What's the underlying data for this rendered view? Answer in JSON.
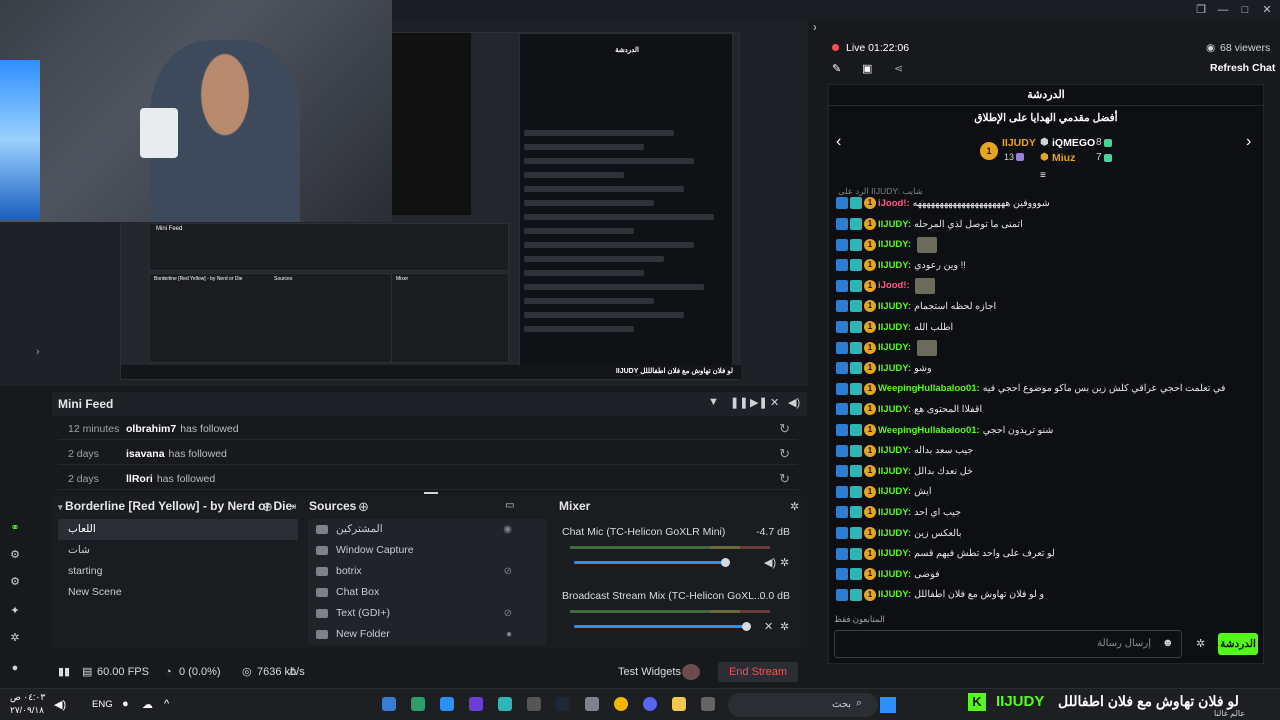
{
  "window": {
    "buttons": [
      "❐",
      "—",
      "□",
      "✕"
    ]
  },
  "preview_overlay": {
    "mini_feed_title": "Mini Feed",
    "scene_title": "Borderline [Red Yellow] - by Nerd or Die",
    "sources_title": "Sources",
    "mixer_title": "Mixer",
    "chat_title_small": "الدردشة",
    "ticker": "IIJUDY  لو فلان تهاوش مع فلان اطفالللل"
  },
  "mini_feed": {
    "title": "Mini Feed",
    "rows": [
      {
        "time": "12 minutes",
        "user": "olbrahim7",
        "action": "has followed"
      },
      {
        "time": "2 days",
        "user": "isavana",
        "action": "has followed"
      },
      {
        "time": "2 days",
        "user": "llRori",
        "action": "has followed"
      }
    ]
  },
  "scenes": {
    "title": "Borderline [Red Yellow] - by Nerd or Die",
    "items": [
      "اللعاب",
      "شات",
      "starting",
      "New Scene"
    ]
  },
  "sources": {
    "title": "Sources",
    "items": [
      "المشتركين",
      "Window Capture",
      "botrix",
      "Chat Box",
      "Text (GDI+)",
      "New Folder"
    ]
  },
  "mixer": {
    "title": "Mixer",
    "channels": [
      {
        "name": "Chat Mic (TC-Helicon GoXLR Mini)",
        "db": "-4.7 dB",
        "level": 0.88
      },
      {
        "name": "Broadcast Stream Mix (TC-Helicon GoXL...",
        "db": "0.0 dB",
        "level": 1.0
      }
    ]
  },
  "status": {
    "fps": "60.00 FPS",
    "dropped": "0 (0.0%)",
    "bitrate": "7636 kb/s",
    "test_widgets": "Test Widgets",
    "end_stream": "End Stream"
  },
  "chat": {
    "live": "Live 01:22:06",
    "viewers": "68 viewers",
    "refresh": "Refresh Chat",
    "tab": "الدردشة",
    "gift_title": "أفضل مقدمي الهدايا على الإطلاق",
    "top_gifters": [
      {
        "rank": "1",
        "name": "IIJUDY",
        "count": "13"
      },
      {
        "rank": "",
        "name": "iQMEGO",
        "count": "8"
      },
      {
        "rank": "",
        "name": "Miuz",
        "count": "7"
      }
    ],
    "reply_hint": "الرد على IIJUDY: شايب",
    "messages": [
      {
        "user": "iJood!",
        "color": "#ff5a8a",
        "text": "شوووفين هههههههههههههههههههههه",
        "emote": false
      },
      {
        "user": "IIJUDY",
        "color": "#53fc18",
        "text": "اتمنى ما توصل لذي المرحله",
        "emote": false
      },
      {
        "user": "IIJUDY",
        "color": "#53fc18",
        "text": "",
        "emote": true
      },
      {
        "user": "IIJUDY",
        "color": "#53fc18",
        "text": "وين رعودي !!",
        "emote": false
      },
      {
        "user": "iJood!",
        "color": "#ff5a8a",
        "text": "",
        "emote": true
      },
      {
        "user": "IIJUDY",
        "color": "#53fc18",
        "text": "اجازه لحظه استجمام",
        "emote": false
      },
      {
        "user": "IIJUDY",
        "color": "#53fc18",
        "text": "اطلب الله",
        "emote": false
      },
      {
        "user": "IIJUDY",
        "color": "#53fc18",
        "text": "",
        "emote": true
      },
      {
        "user": "IIJUDY",
        "color": "#53fc18",
        "text": "وشو",
        "emote": false
      },
      {
        "user": "WeepingHullabaloo01",
        "color": "#53fc18",
        "text": "في تعلمت احجي عراقي كلش زين بس ماكو موضوع احجي فيه",
        "emote": false
      },
      {
        "user": "IIJUDY",
        "color": "#53fc18",
        "text": "اقفلاا المحتوى هع",
        "emote": false
      },
      {
        "user": "WeepingHullabaloo01",
        "color": "#53fc18",
        "text": "شنو تريدون احجي",
        "emote": false
      },
      {
        "user": "IIJUDY",
        "color": "#53fc18",
        "text": "جيب سعد بداله",
        "emote": false
      },
      {
        "user": "IIJUDY",
        "color": "#53fc18",
        "text": "خل نعدك بدالل",
        "emote": false
      },
      {
        "user": "IIJUDY",
        "color": "#53fc18",
        "text": "ايش",
        "emote": false
      },
      {
        "user": "IIJUDY",
        "color": "#53fc18",
        "text": "جيب اي احد",
        "emote": false
      },
      {
        "user": "IIJUDY",
        "color": "#53fc18",
        "text": "بالعكس زين",
        "emote": false
      },
      {
        "user": "IIJUDY",
        "color": "#53fc18",
        "text": "لو تعرف على واحد تطش فيهم قسم",
        "emote": false
      },
      {
        "user": "IIJUDY",
        "color": "#53fc18",
        "text": "فوضى",
        "emote": false
      },
      {
        "user": "IIJUDY",
        "color": "#53fc18",
        "text": "و لو فلان تهاوش مع فلان اطفاللل",
        "emote": false
      }
    ],
    "followers_only": "المتابعون فقط",
    "input_placeholder": "إرسال رسالة",
    "send": "الدردشة"
  },
  "taskbar": {
    "time": "٠٤:٠٣ ص",
    "date": "٢٧/٠٩/١٨",
    "lang": "ENG",
    "search": "بحث",
    "ticker_user": "IIJUDY",
    "ticker_text": "لو فلان تهاوش مع فلان اطفاللل",
    "ticker_sub": "عالم غالنا"
  }
}
